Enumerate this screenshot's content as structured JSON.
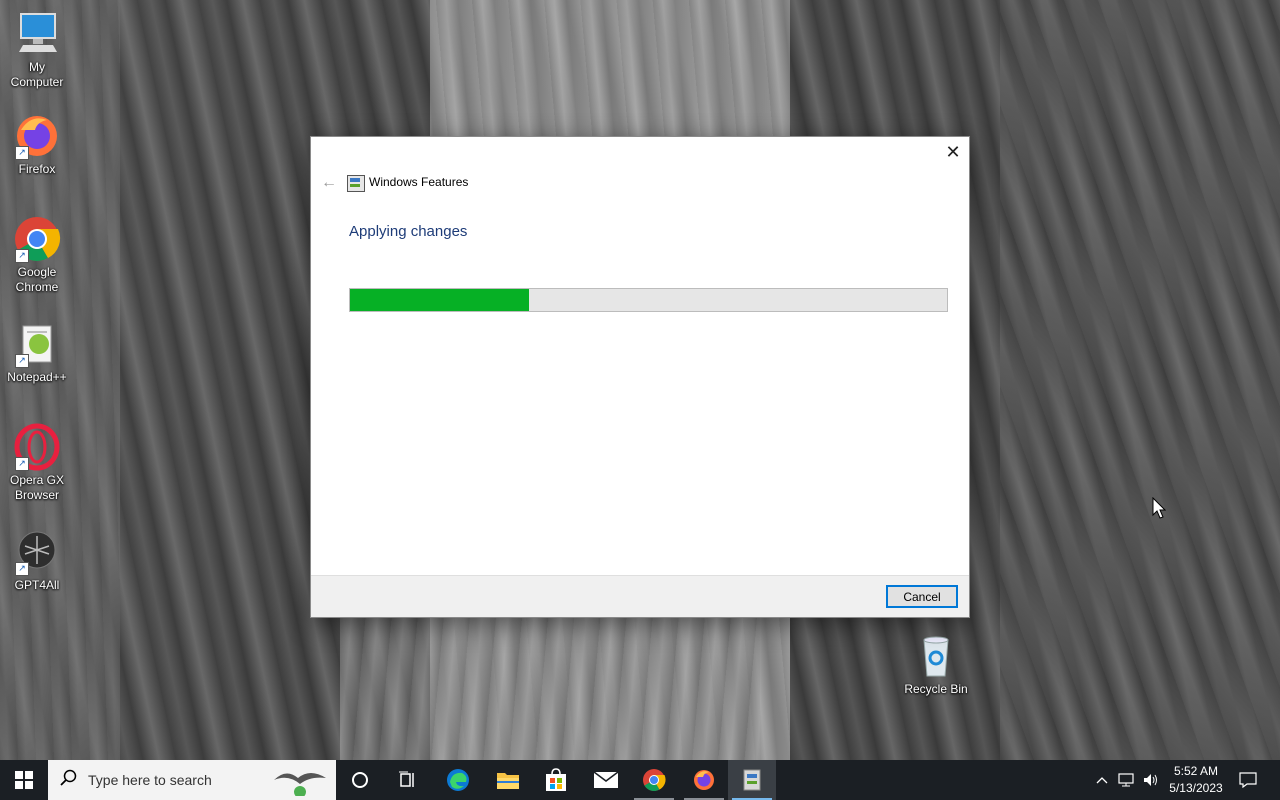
{
  "desktop": {
    "icons": [
      {
        "label": "My Computer",
        "icon": "computer-icon"
      },
      {
        "label": "Firefox",
        "icon": "firefox-icon"
      },
      {
        "label": "Google Chrome",
        "icon": "chrome-icon"
      },
      {
        "label": "Notepad++",
        "icon": "notepadpp-icon"
      },
      {
        "label": "Opera GX Browser",
        "icon": "opera-gx-icon"
      },
      {
        "label": "GPT4All",
        "icon": "gpt4all-icon"
      },
      {
        "label": "Recycle Bin",
        "icon": "recycle-bin-icon"
      }
    ]
  },
  "dialog": {
    "title": "Windows Features",
    "heading": "Applying changes",
    "progress_fraction": 0.3,
    "cancel_label": "Cancel",
    "close_glyph": "✕",
    "back_glyph": "←"
  },
  "taskbar": {
    "search_placeholder": "Type here to search",
    "apps": [
      "cortana-icon",
      "task-view-icon",
      "edge-icon",
      "file-explorer-icon",
      "store-icon",
      "mail-icon",
      "chrome-icon",
      "firefox-icon",
      "windows-features-icon"
    ],
    "active_app": "windows-features-icon",
    "time": "5:52 AM",
    "date": "5/13/2023"
  },
  "colors": {
    "progress_fill": "#06b025",
    "heading": "#1e3c78",
    "taskbar": "#1b1f24",
    "accent": "#0078d7"
  }
}
